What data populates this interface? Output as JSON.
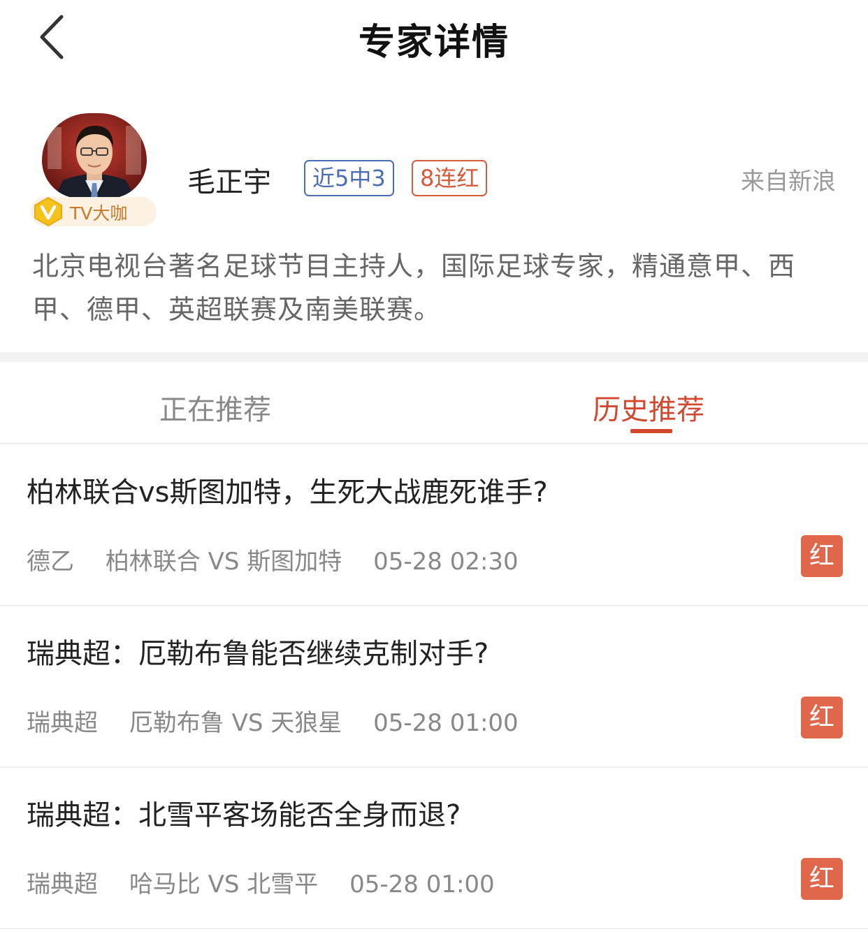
{
  "header": {
    "title": "专家详情",
    "back_icon": "chevron-left-icon"
  },
  "expert": {
    "name": "毛正宇",
    "level_badge": "TV大咖",
    "level_icon": "v-icon",
    "tags": {
      "recent": "近5中3",
      "streak": "8连红"
    },
    "source": "来自新浪",
    "intro": "北京电视台著名足球节目主持人，国际足球专家，精通意甲、西甲、德甲、英超联赛及南美联赛。"
  },
  "tabs": [
    {
      "label": "正在推荐",
      "active": false
    },
    {
      "label": "历史推荐",
      "active": true
    }
  ],
  "records": [
    {
      "title": "柏林联合vs斯图加特，生死大战鹿死谁手?",
      "league": "德乙",
      "match": "柏林联合 VS 斯图加特",
      "time": "05-28 02:30",
      "result": "红"
    },
    {
      "title": "瑞典超：厄勒布鲁能否继续克制对手?",
      "league": "瑞典超",
      "match": "厄勒布鲁 VS 天狼星",
      "time": "05-28 01:00",
      "result": "红"
    },
    {
      "title": "瑞典超：北雪平客场能否全身而退?",
      "league": "瑞典超",
      "match": "哈马比 VS 北雪平",
      "time": "05-28 01:00",
      "result": "红"
    }
  ],
  "colors": {
    "accent": "#d2482e",
    "tag_blue": "#4a6fb0",
    "result_red": "#e0674b",
    "badge_gold": "#f4c21b"
  }
}
